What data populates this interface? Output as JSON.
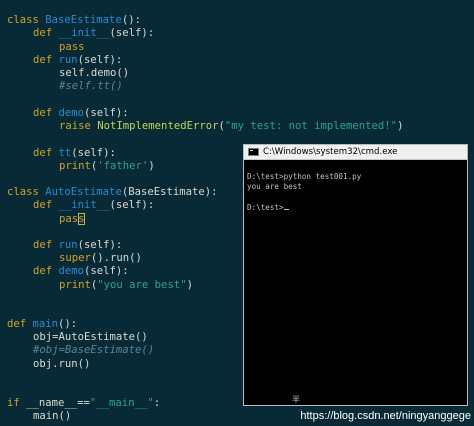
{
  "editor": {
    "l1": {
      "kw": "class ",
      "name": "BaseEstimate",
      "rest": "():"
    },
    "l2": {
      "kw": "def ",
      "name": "__init__",
      "rest": "(self):"
    },
    "l3": {
      "kw": "pass"
    },
    "l4": {
      "kw": "def ",
      "name": "run",
      "rest": "(self):"
    },
    "l5": {
      "text": "self.demo()"
    },
    "l6": {
      "comment": "#self.tt()"
    },
    "l7": {
      "kw": "def ",
      "name": "demo",
      "rest": "(self):"
    },
    "l8": {
      "kw": "raise ",
      "exc": "NotImplementedError",
      "open": "(",
      "str": "\"my test: not implemented!\"",
      "close": ")"
    },
    "l9": {
      "kw": "def ",
      "name": "tt",
      "rest": "(self):"
    },
    "l10": {
      "kw": "print",
      "open": "(",
      "str": "'father'",
      "close": ")"
    },
    "l11": {
      "kw": "class ",
      "name": "AutoEstimate",
      "rest": "(BaseEstimate):"
    },
    "l12": {
      "kw": "def ",
      "name": "__init__",
      "rest": "(self):"
    },
    "l13": {
      "kw": "pas",
      "cursor_char": "s"
    },
    "l14": {
      "kw": "def ",
      "name": "run",
      "rest": "(self):"
    },
    "l15": {
      "kw": "super",
      "rest": "().run()"
    },
    "l16": {
      "kw": "def ",
      "name": "demo",
      "rest": "(self):"
    },
    "l17": {
      "kw": "print",
      "open": "(",
      "str": "\"you are best\"",
      "close": ")"
    },
    "l18": {
      "kw": "def ",
      "name": "main",
      "rest": "():"
    },
    "l19": {
      "text": "obj=AutoEstimate()"
    },
    "l20": {
      "comment": "#obj=BaseEstimate()"
    },
    "l21": {
      "text": "obj.run()"
    },
    "l22": {
      "kw": "if ",
      "text": "__name__==",
      "str": "\"__main__\"",
      "rest": ":"
    },
    "l23": {
      "text": "main()"
    }
  },
  "console": {
    "title": "C:\\Windows\\system32\\cmd.exe",
    "lines": [
      "D:\\test>python test001.py",
      "you are best",
      "",
      "D:\\test>"
    ],
    "ime_indicator": "半"
  },
  "watermark": "https://blog.csdn.net/ningyanggege"
}
